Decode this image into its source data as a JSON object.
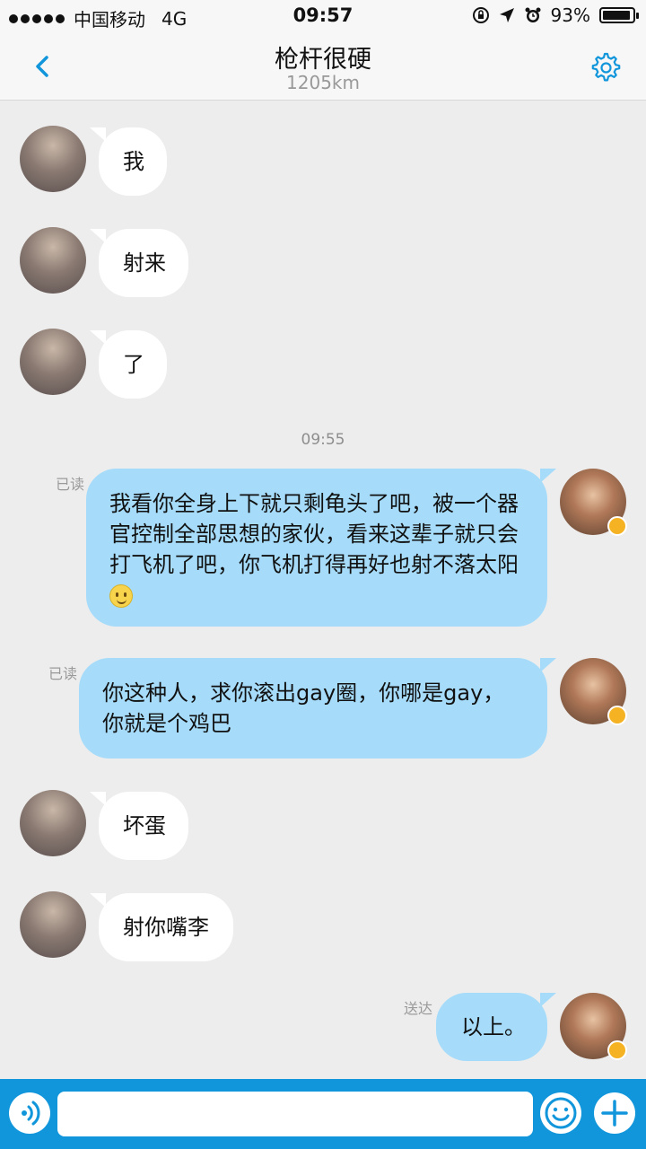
{
  "status": {
    "carrier": "中国移动",
    "network": "4G",
    "time": "09:57",
    "battery": "93%",
    "battery_level": 0.93
  },
  "header": {
    "title": "枪杆很硬",
    "distance": "1205km"
  },
  "messages": [
    {
      "from": "them",
      "text": "我"
    },
    {
      "from": "them",
      "text": "射来"
    },
    {
      "from": "them",
      "text": "了"
    },
    {
      "timestamp": "09:55"
    },
    {
      "from": "me",
      "receipt": "已读",
      "text": "我看你全身上下就只剩龟头了吧，被一个器官控制全部思想的家伙，看来这辈子就只会打飞机了吧，你飞机打得再好也射不落太阳",
      "emoji": "smile-emoji"
    },
    {
      "from": "me",
      "receipt": "已读",
      "text": "你这种人，求你滚出gay圈，你哪是gay，你就是个鸡巴"
    },
    {
      "from": "them",
      "text": "坏蛋"
    },
    {
      "from": "them",
      "text": "射你嘴李"
    },
    {
      "from": "me",
      "receipt": "送达",
      "text": "以上。"
    }
  ],
  "colors": {
    "accent": "#1296db",
    "my_bubble": "#a6dcfa",
    "their_bubble": "#ffffff",
    "background": "#ededed",
    "verified_badge": "#f5b324"
  },
  "icons": {
    "back": "chevron-left-icon",
    "settings": "gear-icon",
    "voice": "voice-icon",
    "emoji": "emoji-icon",
    "plus": "plus-icon"
  }
}
